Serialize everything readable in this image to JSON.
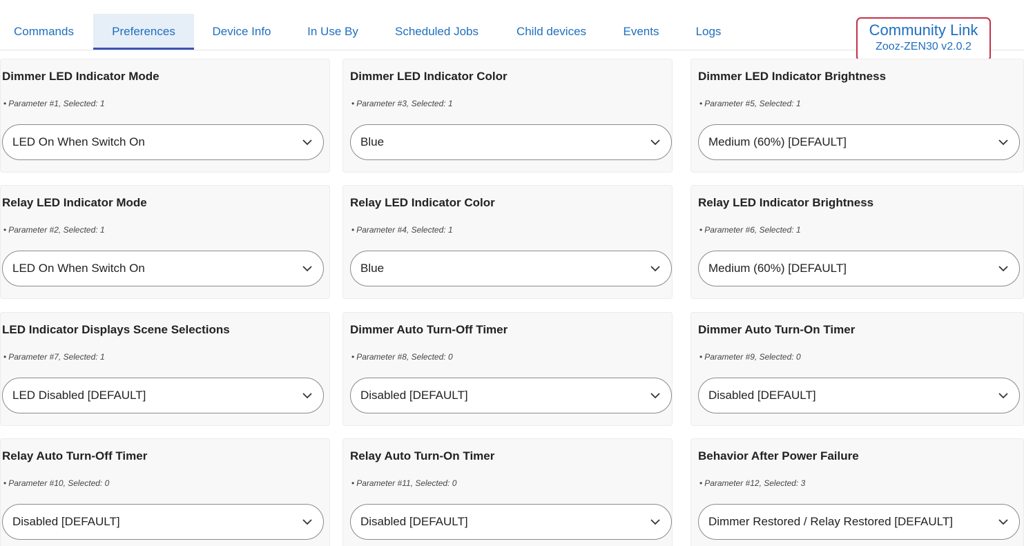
{
  "header": {
    "tabs": [
      {
        "label": "Commands",
        "active": false
      },
      {
        "label": "Preferences",
        "active": true
      },
      {
        "label": "Device Info",
        "active": false
      },
      {
        "label": "In Use By",
        "active": false
      },
      {
        "label": "Scheduled Jobs",
        "active": false
      },
      {
        "label": "Child devices",
        "active": false
      },
      {
        "label": "Events",
        "active": false
      },
      {
        "label": "Logs",
        "active": false
      }
    ],
    "community": {
      "link_label": "Community Link",
      "version": "Zooz-ZEN30 v2.0.2"
    }
  },
  "preferences": [
    {
      "title": "Dimmer LED Indicator Mode",
      "param": "Parameter #1, Selected: 1",
      "value": "LED On When Switch On"
    },
    {
      "title": "Dimmer LED Indicator Color",
      "param": "Parameter #3, Selected: 1",
      "value": "Blue"
    },
    {
      "title": "Dimmer LED Indicator Brightness",
      "param": "Parameter #5, Selected: 1",
      "value": "Medium (60%) [DEFAULT]"
    },
    {
      "title": "Relay LED Indicator Mode",
      "param": "Parameter #2, Selected: 1",
      "value": "LED On When Switch On"
    },
    {
      "title": "Relay LED Indicator Color",
      "param": "Parameter #4, Selected: 1",
      "value": "Blue"
    },
    {
      "title": "Relay LED Indicator Brightness",
      "param": "Parameter #6, Selected: 1",
      "value": "Medium (60%) [DEFAULT]"
    },
    {
      "title": "LED Indicator Displays Scene Selections",
      "param": "Parameter #7, Selected: 1",
      "value": "LED Disabled [DEFAULT]"
    },
    {
      "title": "Dimmer Auto Turn-Off Timer",
      "param": "Parameter #8, Selected: 0",
      "value": "Disabled [DEFAULT]"
    },
    {
      "title": "Dimmer Auto Turn-On Timer",
      "param": "Parameter #9, Selected: 0",
      "value": "Disabled [DEFAULT]"
    },
    {
      "title": "Relay Auto Turn-Off Timer",
      "param": "Parameter #10, Selected: 0",
      "value": "Disabled [DEFAULT]"
    },
    {
      "title": "Relay Auto Turn-On Timer",
      "param": "Parameter #11, Selected: 0",
      "value": "Disabled [DEFAULT]"
    },
    {
      "title": "Behavior After Power Failure",
      "param": "Parameter #12, Selected: 3",
      "value": "Dimmer Restored / Relay Restored [DEFAULT]"
    }
  ],
  "colors": {
    "link": "#1e6fbf",
    "active_tab_bg": "#e6eef7",
    "active_tab_underline": "#3f51b5",
    "community_border": "#c2324a"
  }
}
